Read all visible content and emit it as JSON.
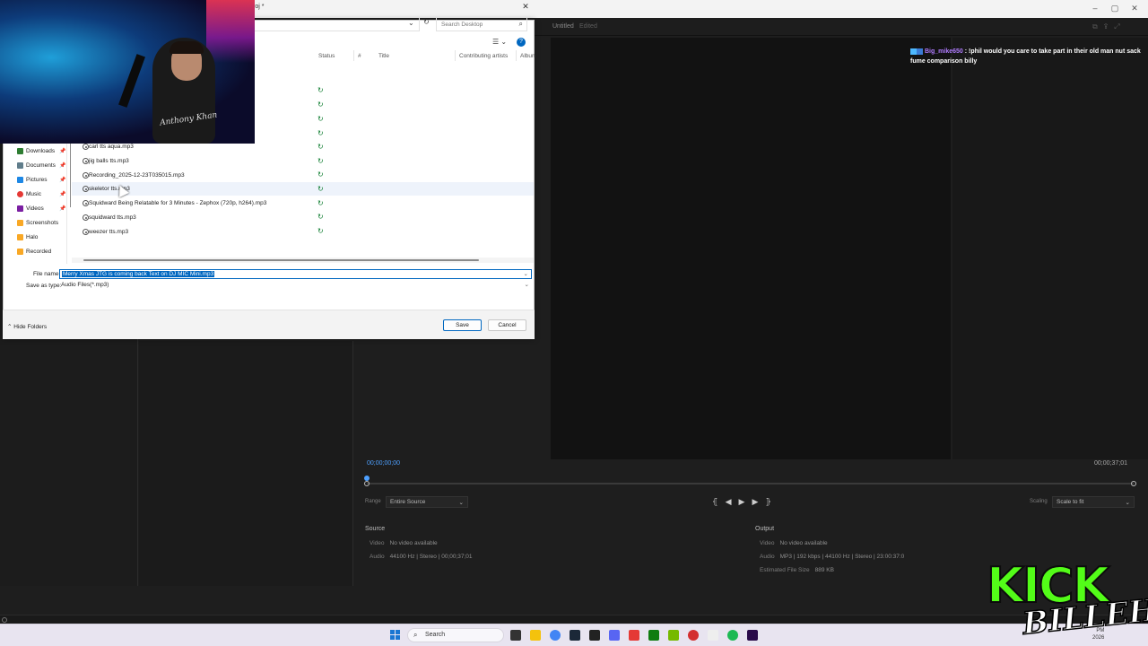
{
  "app": {
    "title": "roj *",
    "document_name": "Untitled",
    "document_status": "Edited"
  },
  "chat": {
    "username": "Big_mike650",
    "message": ": !phil would you care to take part in their old man nut sack fume comparison billy"
  },
  "preview": {
    "timecode_start": "00;00;00;00",
    "timecode_end": "00;00;37;01",
    "range_label": "Range",
    "range_value": "Entire Source",
    "scaling_label": "Scaling",
    "scaling_value": "Scale to fit"
  },
  "source": {
    "heading": "Source",
    "video_label": "Video",
    "video_value": "No video available",
    "audio_label": "Audio",
    "audio_value": "44100 Hz  |  Stereo  |  00;00;37;01"
  },
  "output": {
    "heading": "Output",
    "video_label": "Video",
    "video_value": "No video available",
    "audio_label": "Audio",
    "audio_value": "MP3  |  192 kbps  |  44100 Hz  |  Stereo  |  23:00:37:0",
    "size_label": "Estimated File Size",
    "size_value": "889 KB"
  },
  "dialog": {
    "search_placeholder": "Search Desktop",
    "help": "?",
    "columns": [
      "Status",
      "#",
      "Title",
      "Contributing artists",
      "Albun"
    ],
    "nav_items": [
      {
        "label": "Downloads",
        "color": "#2e7d32"
      },
      {
        "label": "Documents",
        "color": "#607d8b"
      },
      {
        "label": "Pictures",
        "color": "#1e88e5"
      },
      {
        "label": "Music",
        "color": "#e53935"
      },
      {
        "label": "Videos",
        "color": "#7b1fa2"
      },
      {
        "label": "Screenshots",
        "color": "#f9a825"
      },
      {
        "label": "Halo",
        "color": "#f9a825"
      },
      {
        "label": "Recorded",
        "color": "#f9a825"
      }
    ],
    "files": [
      "carl tts aqua.mp3",
      "jig balls tts.mp3",
      "Recording_2025-12-23T035015.mp3",
      "skeletor tts.mp3",
      "Squidward Being Relatable for 3 Minutes - Zephox (720p, h264).mp3",
      "squidward tts.mp3",
      "weezer tts.mp3"
    ],
    "file_name_label": "File name:",
    "file_name_value": "Merry Xmas JTG is coming back Text on DJ MIC Mini.mp3",
    "save_type_label": "Save as type:",
    "save_type_value": "Audio Files(*.mp3)",
    "hide_folders": "Hide Folders",
    "save_button": "Save",
    "cancel_button": "Cancel"
  },
  "taskbar": {
    "search_label": "Search",
    "time": "PM",
    "date": "2026"
  },
  "overlay": {
    "kick_logo": "KICK",
    "billeh_logo": "BILLEH",
    "shirt_text": "Anthony Khan"
  },
  "colors": {
    "accent_blue": "#0067c0",
    "kick_green": "#53fc18",
    "timecode_blue": "#4ea0ff"
  }
}
